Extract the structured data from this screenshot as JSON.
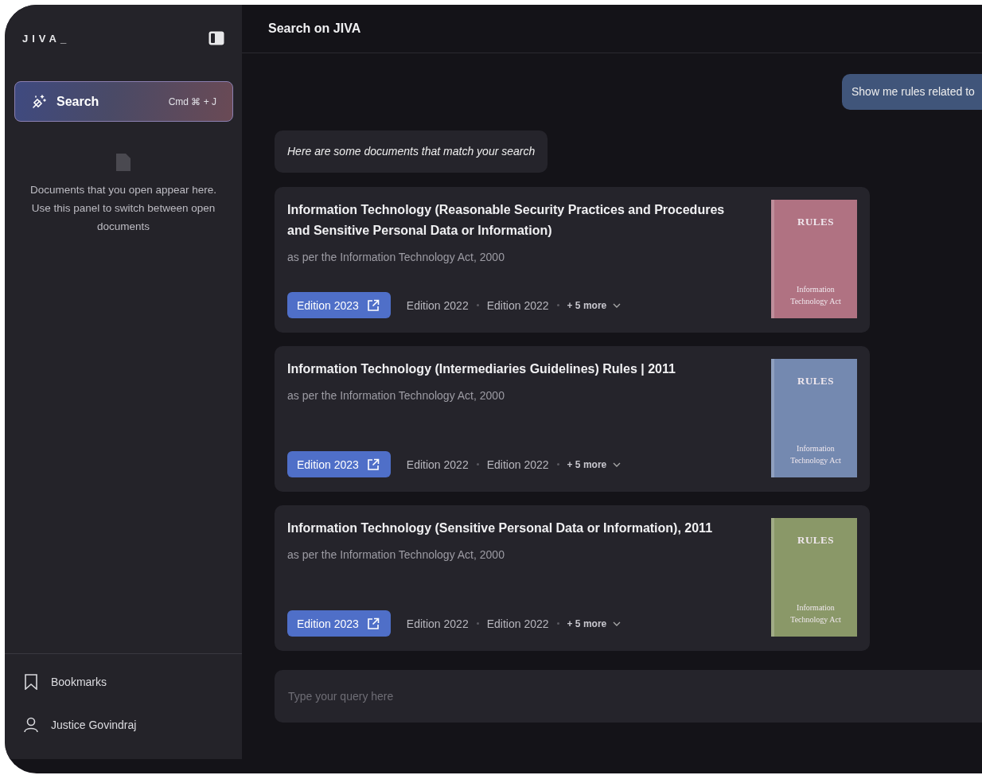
{
  "sidebar": {
    "logo": "JIVA_",
    "search": {
      "label": "Search",
      "shortcut": "Cmd ⌘ + J"
    },
    "empty_text": "Documents that you open appear here. Use this panel to switch between open documents",
    "footer": [
      {
        "kind": "bookmark",
        "label": "Bookmarks"
      },
      {
        "kind": "user",
        "label": "Justice Govindraj"
      }
    ]
  },
  "header": {
    "title": "Search on JIVA"
  },
  "messages": [
    {
      "kind": "user",
      "text": "Show me rules related to"
    },
    {
      "kind": "bot",
      "text": "Here are some documents that match your search"
    }
  ],
  "documents": [
    {
      "title": "Information Technology (Reasonable Security Practices and Procedures and Sensitive Personal Data or Information)",
      "subtitle": "as per the Information Technology Act, 2000",
      "editions": [
        {
          "label": "Edition 2023",
          "selected": true
        },
        {
          "label": "Edition 2022",
          "selected": false
        },
        {
          "label": "Edition 2022",
          "selected": false
        }
      ],
      "more": "+ 5 more",
      "cover": {
        "heading": "RULES",
        "text": "Information Technology Act",
        "color": "#b07282"
      }
    },
    {
      "title": "Information Technology (Intermediaries Guidelines) Rules | 2011",
      "subtitle": "as per the Information Technology Act, 2000",
      "editions": [
        {
          "label": "Edition 2023",
          "selected": true
        },
        {
          "label": "Edition 2022",
          "selected": false
        },
        {
          "label": "Edition 2022",
          "selected": false
        }
      ],
      "more": "+ 5 more",
      "cover": {
        "heading": "RULES",
        "text": "Information Technology Act",
        "color": "#7489b0"
      }
    },
    {
      "title": "Information Technology (Sensitive Personal Data or Information), 2011",
      "subtitle": "as per the Information Technology Act, 2000",
      "editions": [
        {
          "label": "Edition 2023",
          "selected": true
        },
        {
          "label": "Edition 2022",
          "selected": false
        },
        {
          "label": "Edition 2022",
          "selected": false
        }
      ],
      "more": "+ 5 more",
      "cover": {
        "heading": "RULES",
        "text": "Information Technology Act",
        "color": "#8a9868"
      }
    }
  ],
  "input": {
    "placeholder": "Type your query here"
  }
}
